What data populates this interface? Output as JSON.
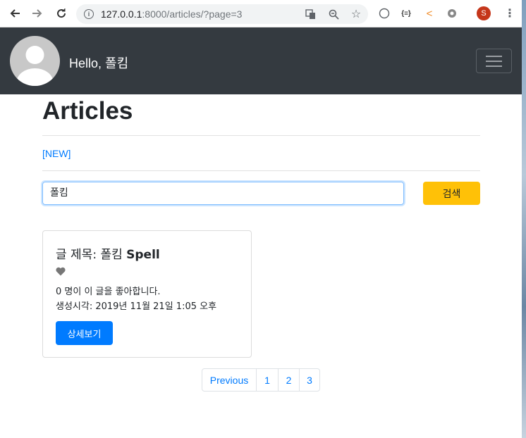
{
  "browser": {
    "url_host": "127.0.0.1",
    "url_rest": ":8000/articles/?page=3",
    "profile_initial": "S"
  },
  "navbar": {
    "greeting": "Hello, 폴킴"
  },
  "main": {
    "title": "Articles",
    "new_link": "[NEW]",
    "search_value": "폴킴",
    "search_button": "검색"
  },
  "articles": [
    {
      "title_prefix": "글 제목: 폴킴 ",
      "title_bold": "Spell",
      "likes_text": "0 명이 이 글을 좋아합니다.",
      "created_text": "생성시각: 2019년 11월 21일 1:05 오후",
      "detail_button": "상세보기"
    }
  ],
  "pagination": {
    "previous": "Previous",
    "pages": [
      "1",
      "2",
      "3"
    ]
  },
  "colors": {
    "navbar": "#343a40",
    "primary": "#007bff",
    "warning": "#ffc107"
  }
}
